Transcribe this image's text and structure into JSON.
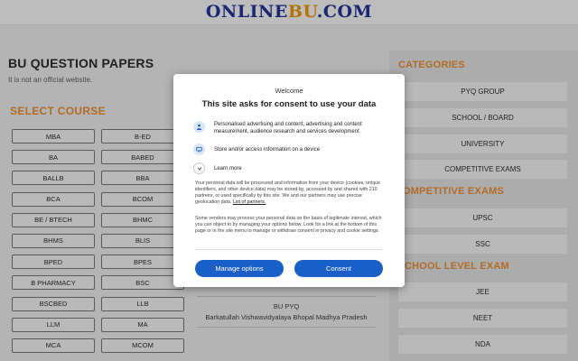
{
  "header": {
    "logo_part1": "ONLINE",
    "logo_part2": "BU",
    "logo_part3": ".COM"
  },
  "left": {
    "title": "BU QUESTION PAPERS",
    "disclaimer": "It is not an official website.",
    "select_course": "SELECT COURSE",
    "courses": [
      "MBA",
      "B-ED",
      "BA",
      "BABED",
      "BALLB",
      "BBA",
      "BCA",
      "BCOM",
      "BE / BTECH",
      "BHMC",
      "BHMS",
      "BLIS",
      "BPED",
      "BPES",
      "B PHARMACY",
      "BSC",
      "BSCBED",
      "LLB",
      "LLM",
      "MA",
      "MCA",
      "MCOM"
    ]
  },
  "middle": {
    "bu_pyq": "BU PYQ",
    "university": "Barkatullah Vishwavidyalaya Bhopal Madhya Pradesh"
  },
  "right": {
    "categories_heading": "CATEGORIES",
    "categories": [
      "PYQ GROUP",
      "SCHOOL / BOARD",
      "UNIVERSITY",
      "COMPETITIVE EXAMS"
    ],
    "competitive_heading": "OMPETITIVE EXAMS",
    "competitive": [
      "UPSC",
      "SSC"
    ],
    "school_heading": "CHOOL LEVEL EXAM",
    "school": [
      "JEE",
      "NEET",
      "NDA"
    ]
  },
  "consent": {
    "welcome": "Welcome",
    "title": "This site asks for consent to use your data",
    "item1": "Personalised advertising and content, advertising and content measurement, audience research and services development",
    "item2": "Store and/or access information on a device",
    "learn_more": "Learn more",
    "body1": "Your personal data will be processed and information from your device (cookies, unique identifiers, and other device data) may be stored by, accessed by and shared with 210 partners, or used specifically by this site. We and our partners may use precise geolocation data.",
    "partners_link": "List of partners.",
    "body2": "Some vendors may process your personal data on the basis of legitimate interest, which you can object to by managing your options below. Look for a link at the bottom of this page or in the site menu to manage or withdraw consent in privacy and cookie settings.",
    "manage_label": "Manage options",
    "consent_label": "Consent"
  },
  "colors": {
    "accent": "#d9822b",
    "brand": "#1a2a8a",
    "button": "#1a5fc7"
  }
}
